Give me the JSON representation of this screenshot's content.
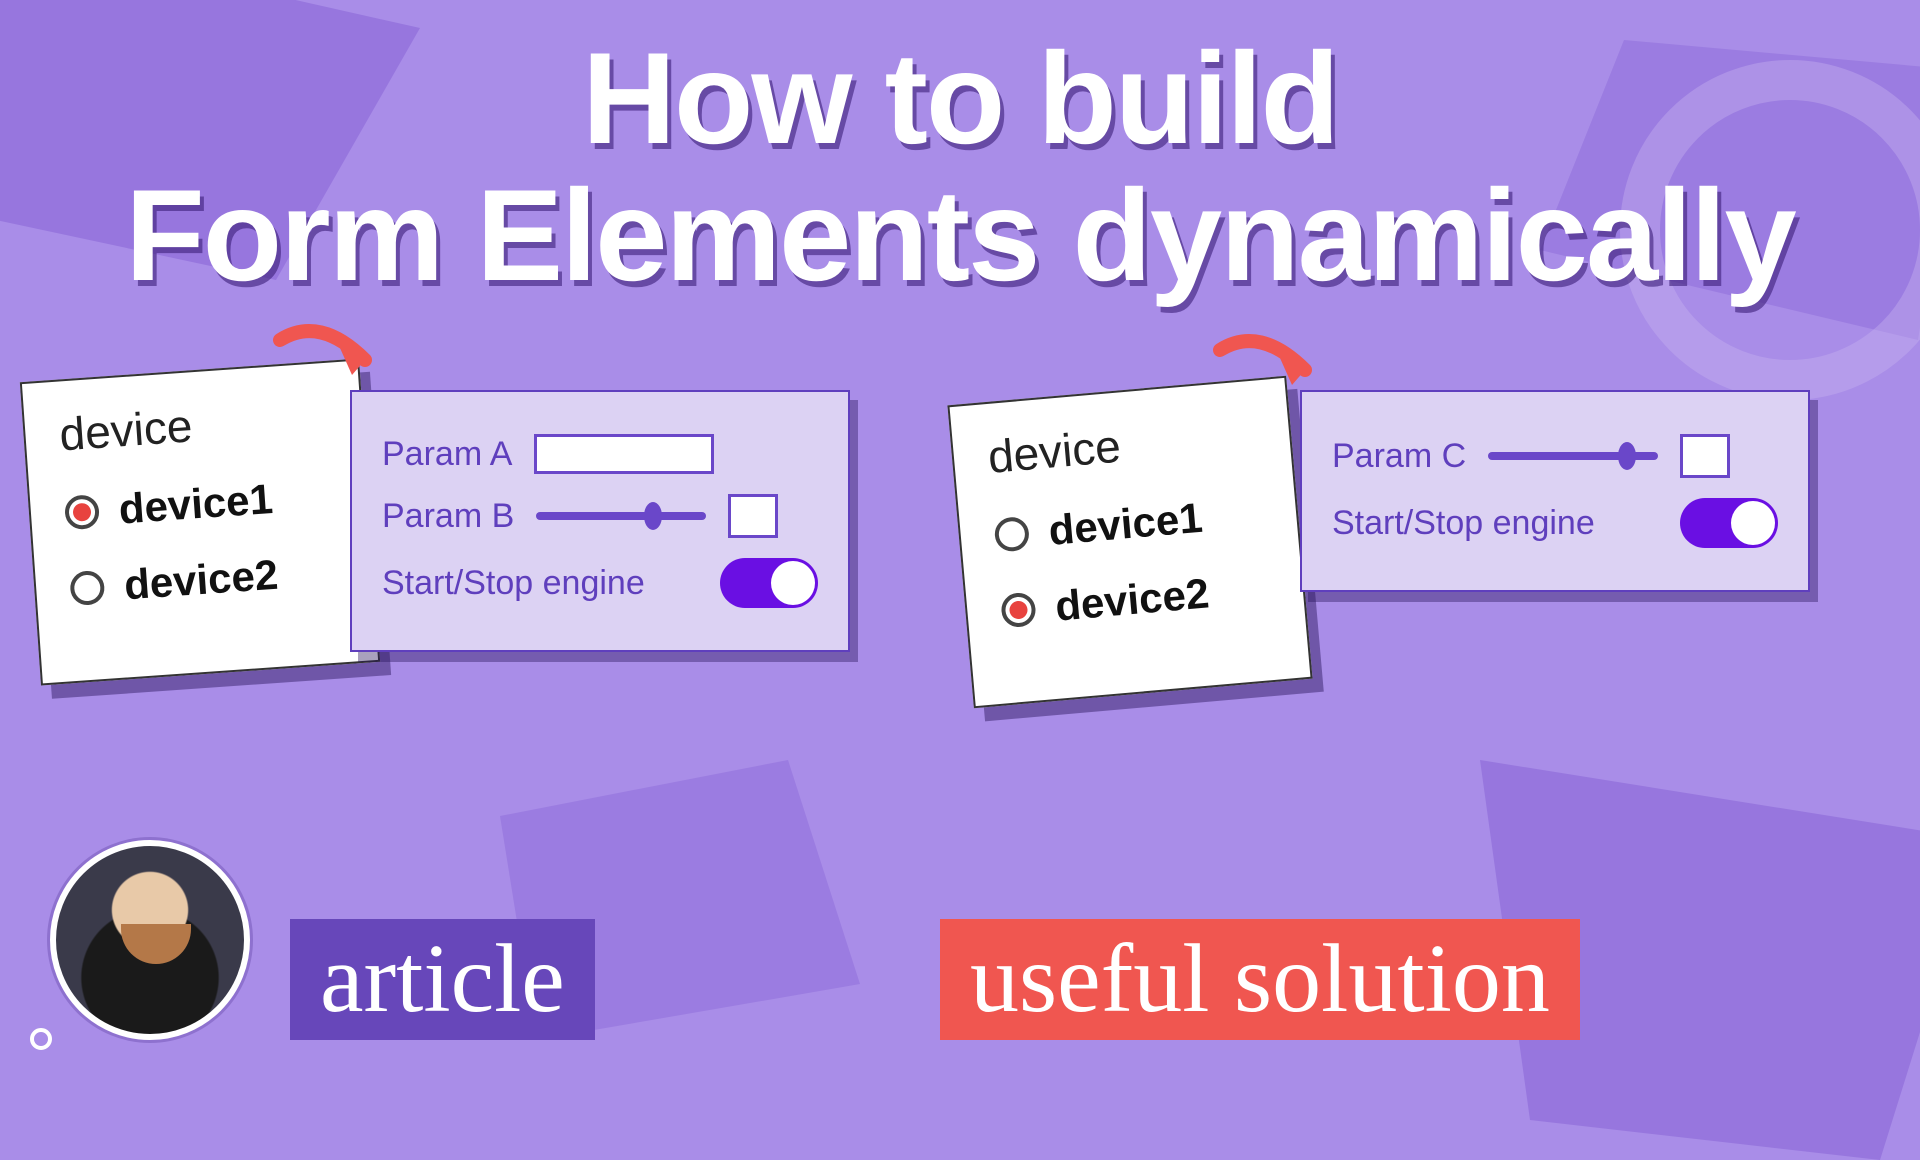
{
  "headline": {
    "l1": "How to build",
    "l2": "Form Elements dynamically"
  },
  "card1": {
    "title": "device",
    "opts": [
      "device1",
      "device2"
    ],
    "selected": 0
  },
  "card2": {
    "title": "device",
    "opts": [
      "device1",
      "device2"
    ],
    "selected": 1
  },
  "panel1": {
    "paramA": "Param A",
    "paramB": "Param B",
    "toggle": "Start/Stop engine"
  },
  "panel2": {
    "paramC": "Param C",
    "toggle": "Start/Stop engine"
  },
  "tags": {
    "article": "article",
    "solution": "useful solution"
  }
}
